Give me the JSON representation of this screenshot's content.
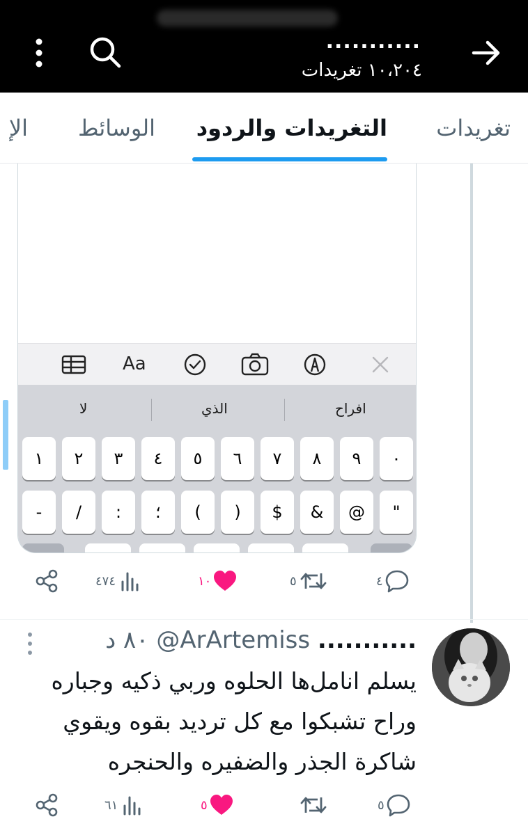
{
  "header": {
    "title": "...........",
    "subtitle": "١٠،٢٠٤ تغريدات"
  },
  "tabs": [
    {
      "label": "تغريدات",
      "active": false
    },
    {
      "label": "التغريدات والردود",
      "active": true
    },
    {
      "label": "الوسائط",
      "active": false
    },
    {
      "label": "الإ",
      "active": false
    }
  ],
  "media_card": {
    "suggestions": [
      "افراح",
      "الذي",
      "لا"
    ],
    "keys_row1": [
      "١",
      "٢",
      "٣",
      "٤",
      "٥",
      "٦",
      "٧",
      "٨",
      "٩",
      "٠"
    ],
    "keys_row2": [
      "-",
      "/",
      ":",
      "؛",
      "(",
      ")",
      "$",
      "&",
      "@",
      "\""
    ],
    "toolbar_icons": [
      "table-icon",
      "text-format-icon",
      "checklist-icon",
      "camera-icon",
      "markup-icon",
      "close-icon"
    ],
    "toolbar_format_label": "Aa"
  },
  "tweet1_actions": {
    "replies": "٤",
    "retweets": "٥",
    "likes": "١٠",
    "views": "٤٧٤"
  },
  "tweet2": {
    "author_name": "...........",
    "handle": "@ArArtemiss",
    "time": "٨٠ د",
    "text": "يسلم انامل‌ها الحلوه وربي ذكيه وجباره وراح تشبكوا مع كل ترديد بقوه ويقوي شاكرة الجذر والضفيره والحنجره",
    "actions": {
      "replies": "٥",
      "retweets": "",
      "likes": "٥",
      "views": "٦١"
    }
  },
  "colors": {
    "accent": "#1d9bf0",
    "like": "#f91880",
    "muted": "#536471"
  }
}
